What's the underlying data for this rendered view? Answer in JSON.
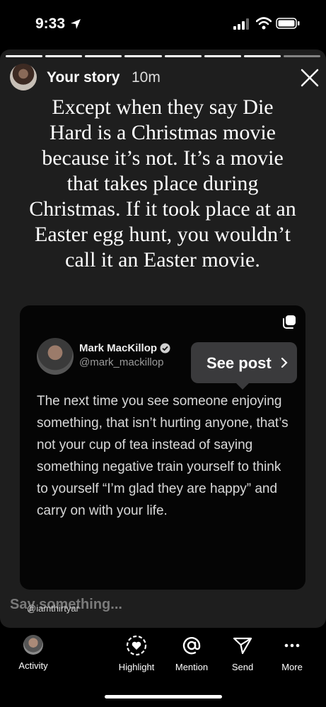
{
  "status_bar": {
    "time": "9:33"
  },
  "story": {
    "user": "Your story",
    "time_ago": "10m",
    "progress_segments": 8,
    "caption": "Except when they say Die Hard is a Christmas movie because it’s not. It’s a movie that takes place during Christmas. If it took place at an Easter egg hunt, you wouldn’t call it an Easter movie."
  },
  "post": {
    "author_name": "Mark MacKillop",
    "author_handle": "@mark_mackillop",
    "text": "The next time you see someone enjoying something, that isn’t hurting anyone, that’s not your cup of tea instead of saying something negative train yourself to think to yourself “I’m glad they are happy” and carry on with your life.",
    "see_post_label": "See post"
  },
  "reply": {
    "placeholder": "Say something...",
    "watermark": "@iamthirtyar"
  },
  "bottom_actions": [
    {
      "label": "Activity",
      "icon": "avatar"
    },
    {
      "label": "Highlight",
      "icon": "highlight-heart-icon"
    },
    {
      "label": "Mention",
      "icon": "at-icon"
    },
    {
      "label": "Send",
      "icon": "send-icon"
    },
    {
      "label": "More",
      "icon": "ellipsis-icon"
    }
  ]
}
